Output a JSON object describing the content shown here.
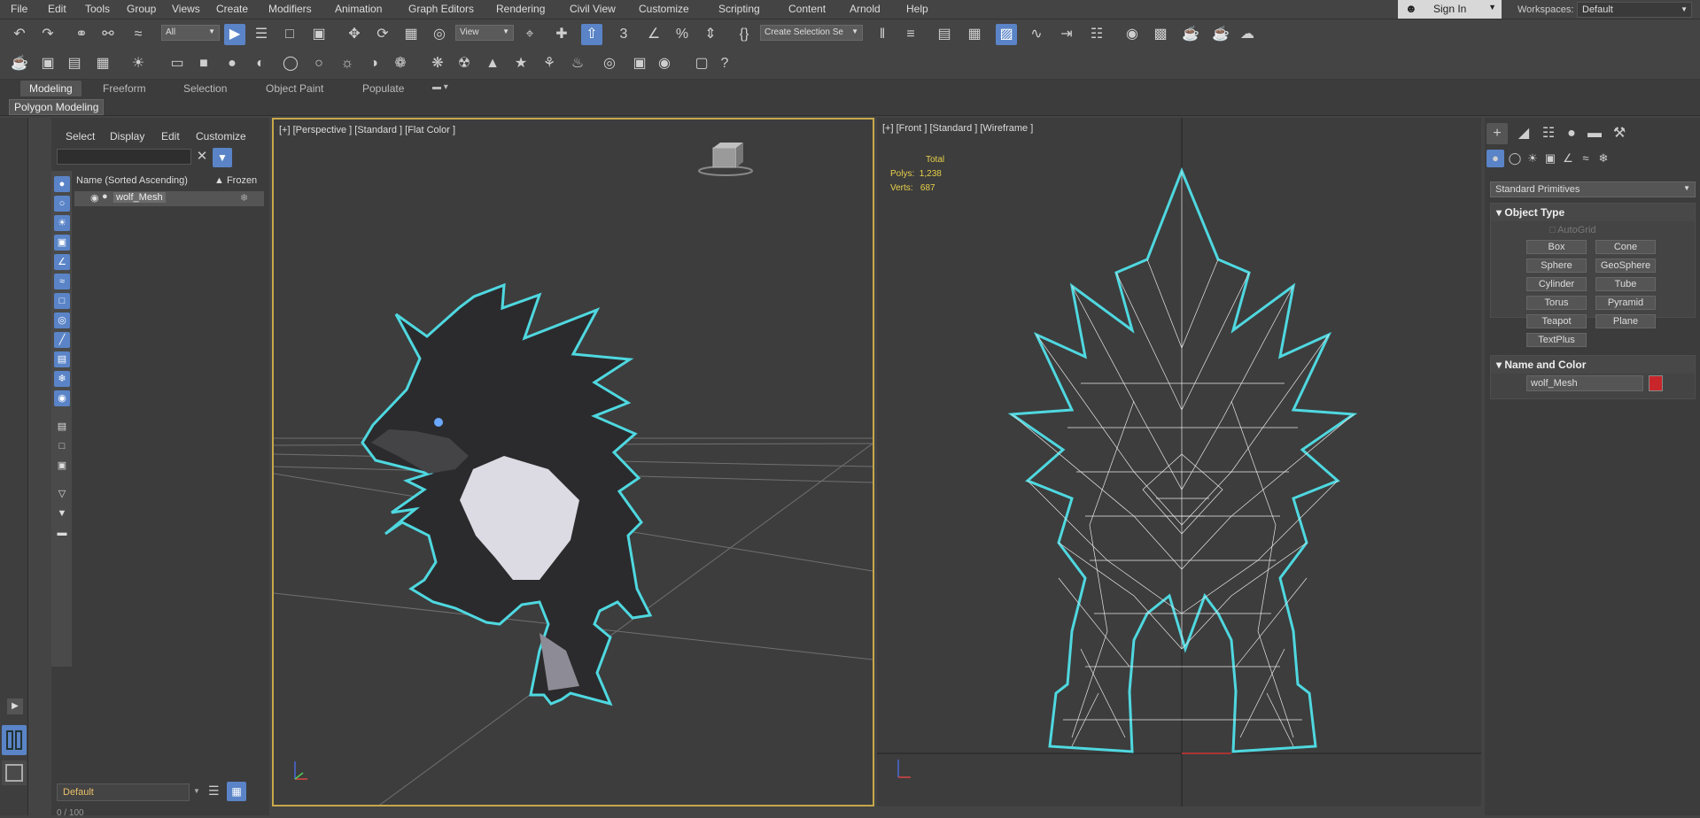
{
  "menubar": {
    "items": [
      "File",
      "Edit",
      "Tools",
      "Group",
      "Views",
      "Create",
      "Modifiers",
      "Animation",
      "Graph Editors",
      "Rendering",
      "Civil View",
      "Customize",
      "Scripting",
      "Content",
      "Arnold",
      "Help"
    ],
    "sign_in": "Sign In",
    "workspaces_label": "Workspaces:",
    "workspace_value": "Default"
  },
  "toolbar": {
    "filter_value": "All",
    "ref_coord_value": "View",
    "selection_set_value": "Create Selection Se"
  },
  "ribbon": {
    "tabs": [
      "Modeling",
      "Freeform",
      "Selection",
      "Object Paint",
      "Populate"
    ],
    "active_tab": "Modeling",
    "panel_label": "Polygon Modeling"
  },
  "scene_explorer": {
    "menu": [
      "Select",
      "Display",
      "Edit",
      "Customize"
    ],
    "col_name": "Name (Sorted Ascending)",
    "col_frozen": "▲ Frozen",
    "rows": [
      {
        "name": "wolf_Mesh"
      }
    ],
    "layer": "Default"
  },
  "viewport_left": {
    "label": "[+] [Perspective ] [Standard ] [Flat Color ]"
  },
  "viewport_right": {
    "label": "[+] [Front ] [Standard ] [Wireframe ]",
    "stats_total": "Total",
    "stats_polys_label": "Polys:",
    "stats_polys_value": "1,238",
    "stats_verts_label": "Verts:",
    "stats_verts_value": "687"
  },
  "command_panel": {
    "category": "Standard Primitives",
    "object_type_title": "Object Type",
    "autogrid": "AutoGrid",
    "buttons": [
      "Box",
      "Cone",
      "Sphere",
      "GeoSphere",
      "Cylinder",
      "Tube",
      "Torus",
      "Pyramid",
      "Teapot",
      "Plane",
      "TextPlus"
    ],
    "name_color_title": "Name and Color",
    "object_name": "wolf_Mesh",
    "object_color": "#c8262b"
  },
  "colors": {
    "accent": "#5a84c7",
    "active_viewport_border": "#c7a84a",
    "selection_outline": "#4fd8e0",
    "stats_text": "#e8d04a"
  },
  "status": {
    "frame_counter": "0 / 100"
  }
}
